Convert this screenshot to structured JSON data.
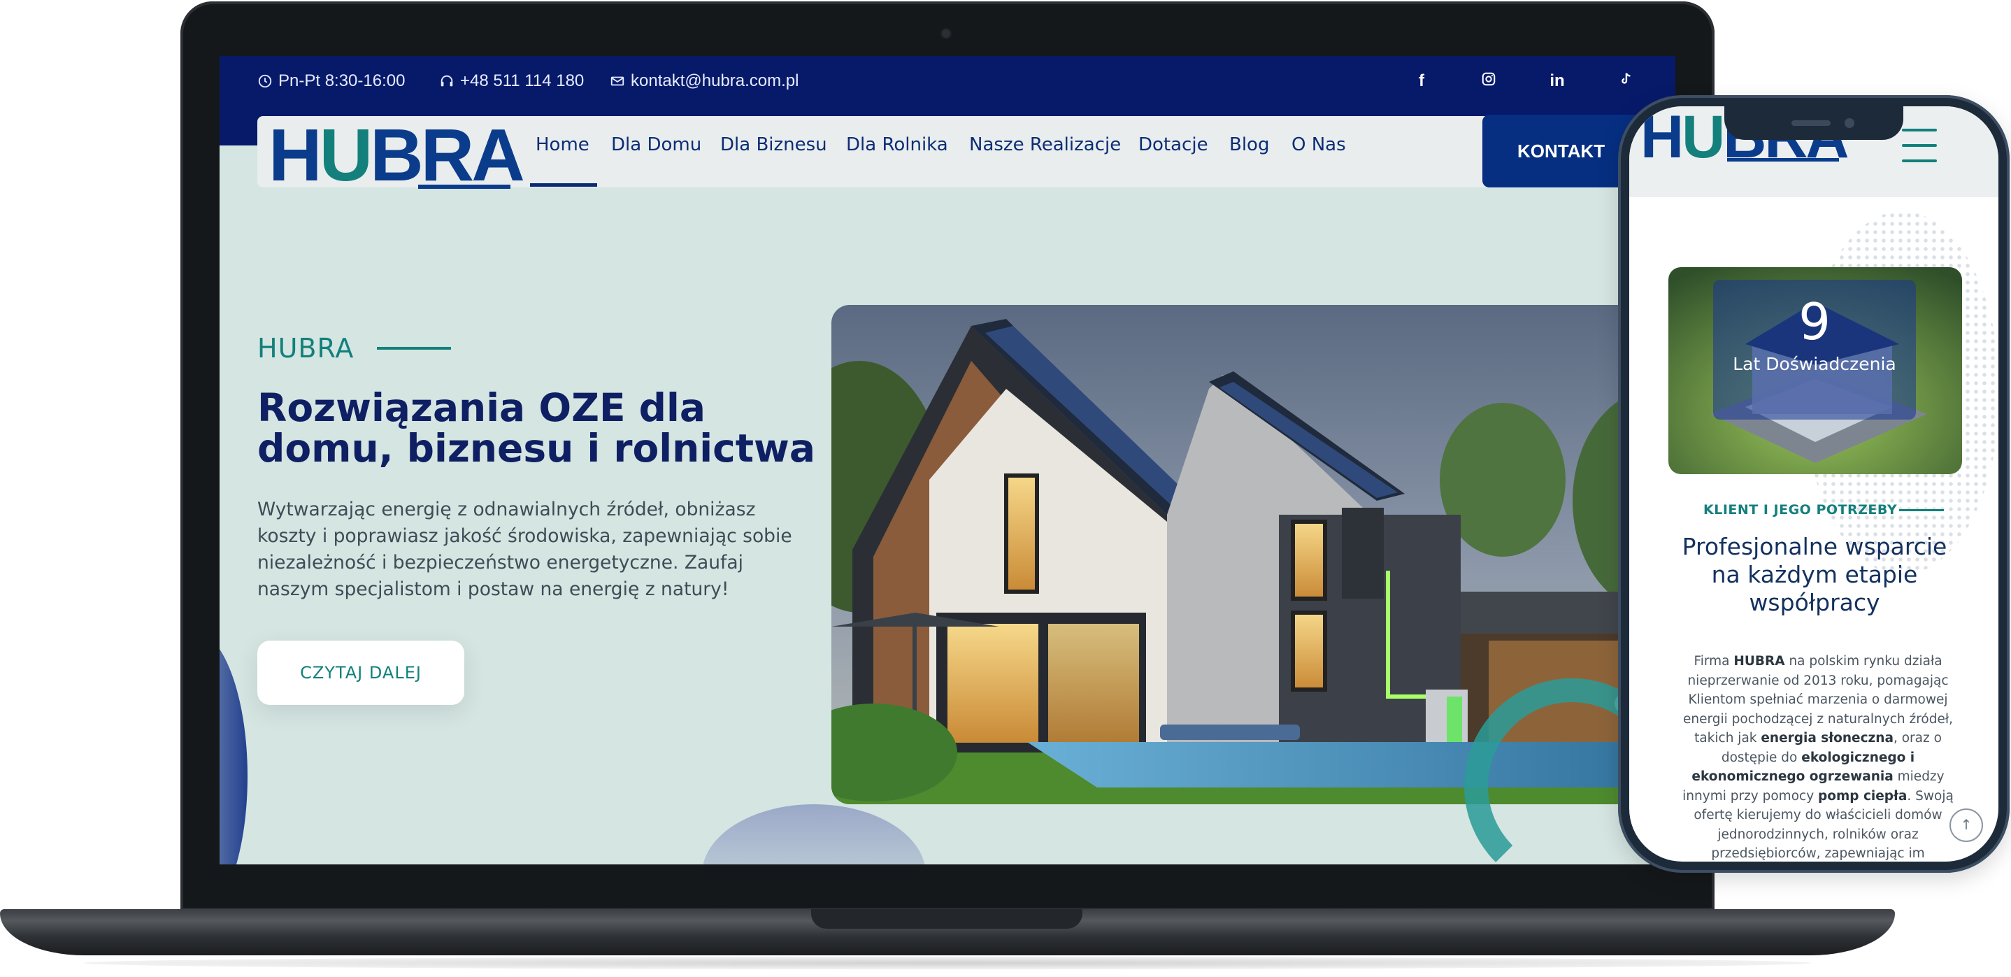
{
  "topbar": {
    "hours": "Pn-Pt 8:30-16:00",
    "phone": "+48 511 114 180",
    "email": "kontakt@hubra.com.pl",
    "social": [
      "f",
      "instagram",
      "in",
      "tiktok"
    ]
  },
  "brand": {
    "logo_part1": "H",
    "logo_part2": "U",
    "logo_part3": "BRA",
    "colors": {
      "navy": "#071a6a",
      "teal": "#12807c",
      "bg": "#d5e5e1"
    }
  },
  "nav": {
    "items": [
      "Home",
      "Dla Domu",
      "Dla Biznesu",
      "Dla Rolnika",
      "Nasze Realizacje",
      "Dotacje",
      "Blog",
      "O Nas"
    ],
    "active": "Home",
    "cta": "KONTAKT"
  },
  "hero": {
    "kicker": "HUBRA",
    "title": "Rozwiązania OZE dla domu, biznesu i rolnictwa",
    "description": "Wytwarzając energię z odnawialnych źródeł, obniżasz koszty i poprawiasz jakość środowiska, zapewniając sobie niezależność i bezpieczeństwo energetyczne. Zaufaj naszym specjalistom i postaw na energię z natury!",
    "button": "CZYTAJ DALEJ"
  },
  "mobile": {
    "counter_value": "9",
    "counter_label": "Lat Doświadczenia",
    "kicker": "KLIENT I JEGO POTRZEBY",
    "title": "Profesjonalne wsparcie na każdym etapie współpracy",
    "body": {
      "p1": "Firma ",
      "b1": "HUBRA",
      "p2": " na polskim rynku działa nieprzerwanie od 2013 roku, pomagając Klientom spełniać marzenia o darmowej energii pochodzącej z naturalnych źródeł, takich jak ",
      "b2": "energia słoneczna",
      "p3": ", oraz o dostępie do ",
      "b3": "ekologicznego i ekonomicznego ogrzewania",
      "p4": " miedzy innymi przy pomocy ",
      "b4": "pomp ciepła",
      "p5": ". Swoją ofertę kierujemy do właścicieli domów jednorodzinnych, rolników oraz przedsiębiorców, zapewniając im kompleksowe wsparcie na każdym etapie"
    }
  }
}
